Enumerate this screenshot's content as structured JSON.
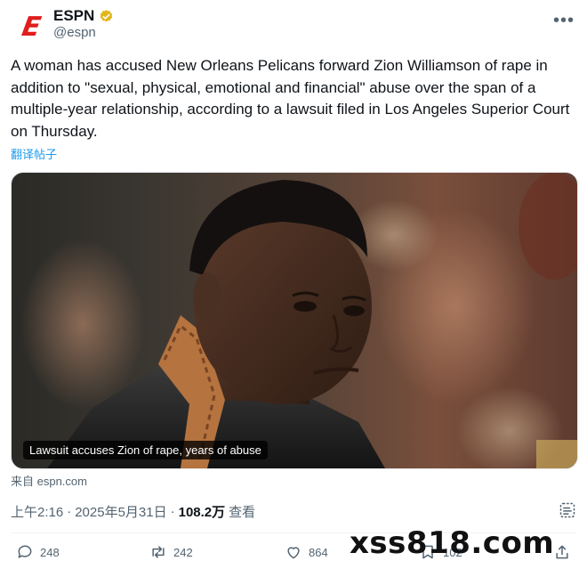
{
  "account": {
    "name": "ESPN",
    "handle": "@espn",
    "avatar_icon": "espn-logo",
    "verified": true
  },
  "post": {
    "text": "A woman has accused New Orleans Pelicans forward Zion Williamson of rape in addition to \"sexual, physical, emotional and financial\" abuse over the span of a multiple-year relationship, according to a lawsuit filed in Los Angeles Superior Court on Thursday.",
    "translate_label": "翻译帖子",
    "media_caption": "Lawsuit accuses Zion of rape, years of abuse",
    "source": "来自 espn.com",
    "time": "上午2:16",
    "date": "2025年5月31日",
    "views": "108.2万",
    "views_label": "查看"
  },
  "actions": {
    "replies": "248",
    "reposts": "242",
    "likes": "864",
    "bookmarks": "102"
  },
  "watermark": "xss818.com",
  "colors": {
    "accent": "#1d9bf0",
    "espn_red": "#e11d1d",
    "verified_gold": "#e2b719"
  }
}
